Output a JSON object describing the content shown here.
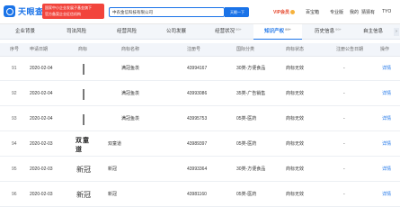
{
  "header": {
    "logo_text": "天眼查",
    "promo_line1": "国家中小企业发展子基金旗下",
    "promo_line2": "官方备案企业征信机构",
    "search_value": "中农金信科技有限公司",
    "search_button": "天眼一下",
    "vip_label": "VIP会员",
    "nav_items": [
      "百宝箱",
      "专业版",
      "我的",
      "猜猜有",
      "TYO"
    ]
  },
  "tabs": [
    {
      "label": "企业背景",
      "count": ""
    },
    {
      "label": "司法风险",
      "count": ""
    },
    {
      "label": "经营风险",
      "count": ""
    },
    {
      "label": "公司发展",
      "count": ""
    },
    {
      "label": "经营状况",
      "count": "99+"
    },
    {
      "label": "知识产权",
      "count": "99+",
      "active": true
    },
    {
      "label": "历史信息",
      "count": "99+"
    },
    {
      "label": "自主信息",
      "count": ""
    }
  ],
  "table": {
    "columns": [
      "序号",
      "申请日期",
      "商标",
      "商标名称",
      "注册号",
      "国际分类",
      "商标状态",
      "注册公告日期",
      "操作"
    ],
    "rows": [
      {
        "idx": "91",
        "date": "2020-02-04",
        "thumb": "line",
        "name": "满冠鱼羡",
        "reg": "43994167",
        "class": "30类-方便食品",
        "status": "商标无效",
        "pub": "-",
        "op": "详情"
      },
      {
        "idx": "92",
        "date": "2020-02-04",
        "thumb": "line",
        "name": "满冠鱼羡",
        "reg": "43993086",
        "class": "35类-广告销售",
        "status": "商标无效",
        "pub": "-",
        "op": "详情"
      },
      {
        "idx": "93",
        "date": "2020-02-04",
        "thumb": "line",
        "name": "满冠鱼羡",
        "reg": "43995753",
        "class": "05类-医药",
        "status": "商标无效",
        "pub": "-",
        "op": "详情"
      },
      {
        "idx": "94",
        "date": "2020-02-03",
        "thumb": "calligraphy",
        "thumb_text": "双童道",
        "name": "双童道",
        "reg": "43989397",
        "class": "05类-医药",
        "status": "商标无效",
        "pub": "-",
        "op": "详情"
      },
      {
        "idx": "95",
        "date": "2020-02-03",
        "thumb": "xinguan",
        "thumb_text": "新冠",
        "name": "新冠",
        "reg": "43993364",
        "class": "30类-方便食品",
        "status": "商标无效",
        "pub": "-",
        "op": "详情"
      },
      {
        "idx": "96",
        "date": "2020-02-03",
        "thumb": "xinguan",
        "thumb_text": "新冠",
        "name": "新冠",
        "reg": "43981160",
        "class": "05类-医药",
        "status": "商标无效",
        "pub": "-",
        "op": "详情"
      }
    ]
  },
  "colors": {
    "brand": "#1a73e8",
    "promo": "#f2443c",
    "vip": "#e5472c"
  }
}
